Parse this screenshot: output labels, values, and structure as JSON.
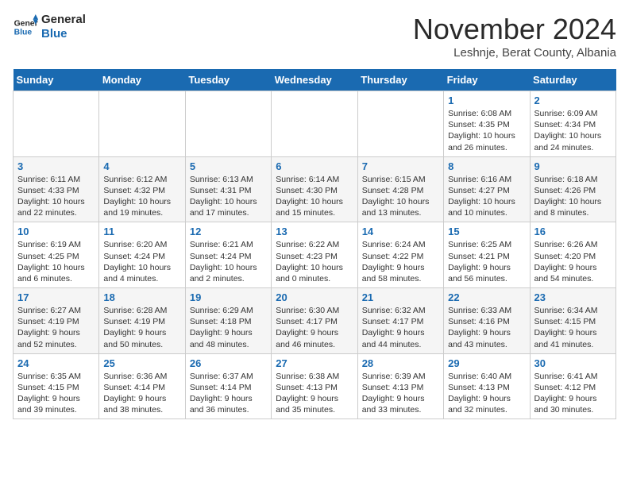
{
  "logo": {
    "line1": "General",
    "line2": "Blue"
  },
  "title": "November 2024",
  "subtitle": "Leshnje, Berat County, Albania",
  "days_of_week": [
    "Sunday",
    "Monday",
    "Tuesday",
    "Wednesday",
    "Thursday",
    "Friday",
    "Saturday"
  ],
  "weeks": [
    [
      {
        "day": "",
        "info": ""
      },
      {
        "day": "",
        "info": ""
      },
      {
        "day": "",
        "info": ""
      },
      {
        "day": "",
        "info": ""
      },
      {
        "day": "",
        "info": ""
      },
      {
        "day": "1",
        "info": "Sunrise: 6:08 AM\nSunset: 4:35 PM\nDaylight: 10 hours and 26 minutes."
      },
      {
        "day": "2",
        "info": "Sunrise: 6:09 AM\nSunset: 4:34 PM\nDaylight: 10 hours and 24 minutes."
      }
    ],
    [
      {
        "day": "3",
        "info": "Sunrise: 6:11 AM\nSunset: 4:33 PM\nDaylight: 10 hours and 22 minutes."
      },
      {
        "day": "4",
        "info": "Sunrise: 6:12 AM\nSunset: 4:32 PM\nDaylight: 10 hours and 19 minutes."
      },
      {
        "day": "5",
        "info": "Sunrise: 6:13 AM\nSunset: 4:31 PM\nDaylight: 10 hours and 17 minutes."
      },
      {
        "day": "6",
        "info": "Sunrise: 6:14 AM\nSunset: 4:30 PM\nDaylight: 10 hours and 15 minutes."
      },
      {
        "day": "7",
        "info": "Sunrise: 6:15 AM\nSunset: 4:28 PM\nDaylight: 10 hours and 13 minutes."
      },
      {
        "day": "8",
        "info": "Sunrise: 6:16 AM\nSunset: 4:27 PM\nDaylight: 10 hours and 10 minutes."
      },
      {
        "day": "9",
        "info": "Sunrise: 6:18 AM\nSunset: 4:26 PM\nDaylight: 10 hours and 8 minutes."
      }
    ],
    [
      {
        "day": "10",
        "info": "Sunrise: 6:19 AM\nSunset: 4:25 PM\nDaylight: 10 hours and 6 minutes."
      },
      {
        "day": "11",
        "info": "Sunrise: 6:20 AM\nSunset: 4:24 PM\nDaylight: 10 hours and 4 minutes."
      },
      {
        "day": "12",
        "info": "Sunrise: 6:21 AM\nSunset: 4:24 PM\nDaylight: 10 hours and 2 minutes."
      },
      {
        "day": "13",
        "info": "Sunrise: 6:22 AM\nSunset: 4:23 PM\nDaylight: 10 hours and 0 minutes."
      },
      {
        "day": "14",
        "info": "Sunrise: 6:24 AM\nSunset: 4:22 PM\nDaylight: 9 hours and 58 minutes."
      },
      {
        "day": "15",
        "info": "Sunrise: 6:25 AM\nSunset: 4:21 PM\nDaylight: 9 hours and 56 minutes."
      },
      {
        "day": "16",
        "info": "Sunrise: 6:26 AM\nSunset: 4:20 PM\nDaylight: 9 hours and 54 minutes."
      }
    ],
    [
      {
        "day": "17",
        "info": "Sunrise: 6:27 AM\nSunset: 4:19 PM\nDaylight: 9 hours and 52 minutes."
      },
      {
        "day": "18",
        "info": "Sunrise: 6:28 AM\nSunset: 4:19 PM\nDaylight: 9 hours and 50 minutes."
      },
      {
        "day": "19",
        "info": "Sunrise: 6:29 AM\nSunset: 4:18 PM\nDaylight: 9 hours and 48 minutes."
      },
      {
        "day": "20",
        "info": "Sunrise: 6:30 AM\nSunset: 4:17 PM\nDaylight: 9 hours and 46 minutes."
      },
      {
        "day": "21",
        "info": "Sunrise: 6:32 AM\nSunset: 4:17 PM\nDaylight: 9 hours and 44 minutes."
      },
      {
        "day": "22",
        "info": "Sunrise: 6:33 AM\nSunset: 4:16 PM\nDaylight: 9 hours and 43 minutes."
      },
      {
        "day": "23",
        "info": "Sunrise: 6:34 AM\nSunset: 4:15 PM\nDaylight: 9 hours and 41 minutes."
      }
    ],
    [
      {
        "day": "24",
        "info": "Sunrise: 6:35 AM\nSunset: 4:15 PM\nDaylight: 9 hours and 39 minutes."
      },
      {
        "day": "25",
        "info": "Sunrise: 6:36 AM\nSunset: 4:14 PM\nDaylight: 9 hours and 38 minutes."
      },
      {
        "day": "26",
        "info": "Sunrise: 6:37 AM\nSunset: 4:14 PM\nDaylight: 9 hours and 36 minutes."
      },
      {
        "day": "27",
        "info": "Sunrise: 6:38 AM\nSunset: 4:13 PM\nDaylight: 9 hours and 35 minutes."
      },
      {
        "day": "28",
        "info": "Sunrise: 6:39 AM\nSunset: 4:13 PM\nDaylight: 9 hours and 33 minutes."
      },
      {
        "day": "29",
        "info": "Sunrise: 6:40 AM\nSunset: 4:13 PM\nDaylight: 9 hours and 32 minutes."
      },
      {
        "day": "30",
        "info": "Sunrise: 6:41 AM\nSunset: 4:12 PM\nDaylight: 9 hours and 30 minutes."
      }
    ]
  ]
}
